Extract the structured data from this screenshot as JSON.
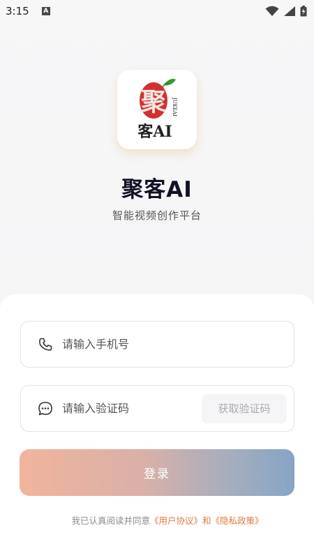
{
  "status_bar": {
    "time": "3:15",
    "indicator": "A"
  },
  "app": {
    "logo_char_main": "聚",
    "logo_char_sub": "客AI",
    "logo_side_text": "JUKEAI",
    "title": "聚客AI",
    "subtitle": "智能视频创作平台"
  },
  "form": {
    "phone_placeholder": "请输入手机号",
    "code_placeholder": "请输入验证码",
    "get_code_label": "获取验证码",
    "login_label": "登录"
  },
  "agreement": {
    "prefix": "我已认真阅读并同意",
    "link_text": "《用户协议》和《隐私政策》"
  },
  "colors": {
    "accent_link": "#e07a3c",
    "logo_red": "#d32f2f",
    "leaf_green": "#3a9a2a"
  }
}
